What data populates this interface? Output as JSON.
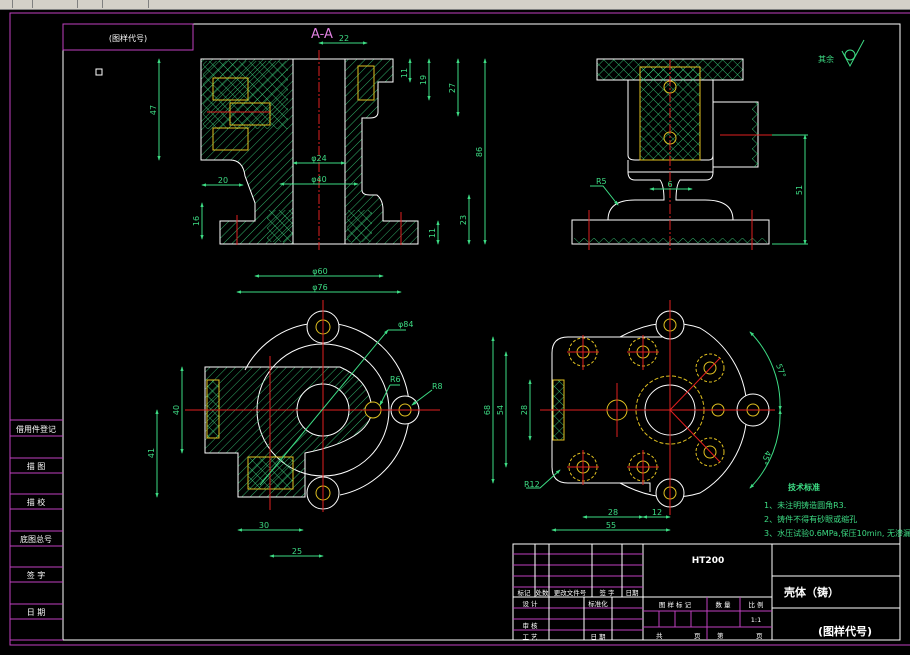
{
  "colors": {
    "background": "#000000",
    "frame": "#c040c0",
    "outline": "#ffffff",
    "dimension": "#3ddc84",
    "centerline": "#e02020",
    "hidden": "#e0c020"
  },
  "caption_box": "(图样代号)",
  "section_label": "A-A",
  "roughness": {
    "label": "其余"
  },
  "view_section": {
    "dims": [
      "22",
      "11",
      "19",
      "27",
      "86",
      "47",
      "20",
      "φ24",
      "φ40",
      "16",
      "23",
      "11",
      "φ60",
      "φ76"
    ]
  },
  "view_side": {
    "dims": [
      "R5",
      "6",
      "51"
    ]
  },
  "view_top_left": {
    "dims": [
      "φ84",
      "R6",
      "R8",
      "40",
      "41",
      "30",
      "25"
    ]
  },
  "view_top_right": {
    "dims": [
      "68",
      "54",
      "28",
      "R12",
      "28",
      "12",
      "55",
      "57°",
      "45°"
    ]
  },
  "tech_notes": {
    "title": "技术标准",
    "items": [
      "1、未注明铸造圆角R3.",
      "2、铸件不得有砂眼或缩孔",
      "3、水压试验0.6MPa,保压10min, 无渗漏"
    ]
  },
  "sidebar": [
    "借用件登记",
    "描 图",
    "描 校",
    "底图总号",
    "签 字",
    "日 期"
  ],
  "title_block": {
    "material": "HT200",
    "part_name": "壳体（铸）",
    "drawing_code": "(图样代号)",
    "rev_headers": [
      "标记",
      "处数",
      "更改文件号",
      "签 字",
      "日期"
    ],
    "design": "设 计",
    "standard": "标准化",
    "review": "审 核",
    "process": "工 艺",
    "date": "日 期",
    "mark": "图 样 标 记",
    "qty": "数 量",
    "scale_label": "比 例",
    "scale": "1:1",
    "total": "共",
    "page_unit": "页",
    "sheet": "第",
    "page_unit2": "页"
  }
}
